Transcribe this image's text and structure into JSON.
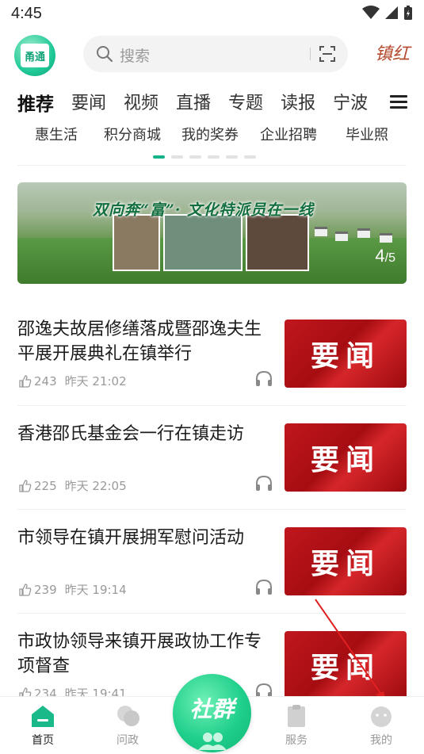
{
  "status_bar": {
    "time": "4:45"
  },
  "header": {
    "logo_text": "甬通",
    "search_placeholder": "搜索",
    "seal_text": "镇红"
  },
  "tabs": [
    {
      "label": "推荐",
      "active": true
    },
    {
      "label": "要闻"
    },
    {
      "label": "视频"
    },
    {
      "label": "直播"
    },
    {
      "label": "专题"
    },
    {
      "label": "读报"
    },
    {
      "label": "宁波"
    }
  ],
  "quick_links": [
    "惠生活",
    "积分商城",
    "我的奖券",
    "企业招聘",
    "毕业照"
  ],
  "quick_links_page": {
    "current": 1,
    "total": 6
  },
  "banner": {
    "title": "双向奔“富”· 文化特派员在一线",
    "page_current": "4",
    "page_total": "/5"
  },
  "news": [
    {
      "title": "邵逸夫故居修缮落成暨邵逸夫生平展开展典礼在镇举行",
      "likes": "243",
      "time": "昨天  21:02",
      "thumb": "要闻"
    },
    {
      "title": "香港邵氏基金会一行在镇走访",
      "likes": "225",
      "time": "昨天  22:05",
      "thumb": "要闻"
    },
    {
      "title": "市领导在镇开展拥军慰问活动",
      "likes": "239",
      "time": "昨天  19:14",
      "thumb": "要闻"
    },
    {
      "title": "市政协领导来镇开展政协工作专项督查",
      "likes": "234",
      "time": "昨天  19:41",
      "thumb": "要闻"
    }
  ],
  "bottom_nav": [
    {
      "label": "首页",
      "active": true
    },
    {
      "label": "问政"
    },
    {
      "label": "服务"
    },
    {
      "label": "我的"
    }
  ],
  "fab": {
    "label": "社群"
  },
  "colors": {
    "accent": "#15b38a",
    "news_thumb": "#b5121a",
    "arrow": "#e02020"
  }
}
